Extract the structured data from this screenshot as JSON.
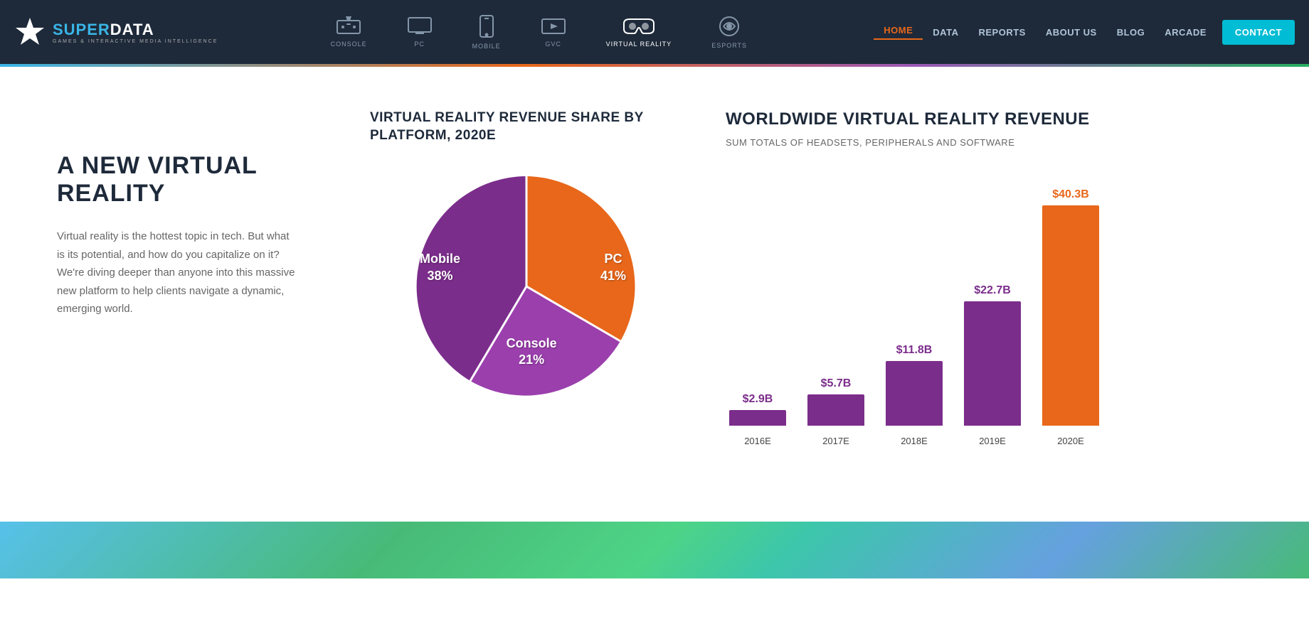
{
  "brand": {
    "name_part1": "SUPER",
    "name_part2": "DATA",
    "tagline": "GAMES & INTERACTIVE MEDIA INTELLIGENCE"
  },
  "categories": [
    {
      "id": "console",
      "label": "CONSOLE",
      "active": false
    },
    {
      "id": "pc",
      "label": "PC",
      "active": false
    },
    {
      "id": "mobile",
      "label": "MOBILE",
      "active": false
    },
    {
      "id": "gvc",
      "label": "GVC",
      "active": false
    },
    {
      "id": "virtual-reality",
      "label": "VIRTUAL REALITY",
      "active": true
    },
    {
      "id": "esports",
      "label": "ESPORTS",
      "active": false
    }
  ],
  "nav": {
    "items": [
      {
        "id": "home",
        "label": "HOME",
        "active": true
      },
      {
        "id": "data",
        "label": "DATA",
        "active": false
      },
      {
        "id": "reports",
        "label": "REPORTS",
        "active": false
      },
      {
        "id": "about-us",
        "label": "ABOUT US",
        "active": false
      },
      {
        "id": "blog",
        "label": "BLOG",
        "active": false
      },
      {
        "id": "arcade",
        "label": "ARCADE",
        "active": false
      }
    ],
    "contact_label": "CONTACT"
  },
  "hero": {
    "title": "A NEW VIRTUAL REALITY",
    "description": "Virtual reality is the hottest topic in tech. But what is its potential, and how do you capitalize on it? We're diving deeper than anyone into this massive new platform to help clients navigate a dynamic, emerging world."
  },
  "pie_chart": {
    "title": "VIRTUAL REALITY REVENUE SHARE BY PLATFORM, 2020E",
    "segments": [
      {
        "label": "PC",
        "value": 41,
        "color": "#e8671a"
      },
      {
        "label": "Mobile",
        "value": 38,
        "color": "#7b2d8b"
      },
      {
        "label": "Console",
        "value": 21,
        "color": "#9b3fad"
      }
    ]
  },
  "bar_chart": {
    "title": "WORLDWIDE VIRTUAL REALITY REVENUE",
    "subtitle": "SUM TOTALS OF HEADSETS, PERIPHERALS AND SOFTWARE",
    "bars": [
      {
        "year": "2016E",
        "value": "$2.9B",
        "amount": 2.9,
        "color": "purple"
      },
      {
        "year": "2017E",
        "value": "$5.7B",
        "amount": 5.7,
        "color": "purple"
      },
      {
        "year": "2018E",
        "value": "$11.8B",
        "amount": 11.8,
        "color": "purple"
      },
      {
        "year": "2019E",
        "value": "$22.7B",
        "amount": 22.7,
        "color": "purple"
      },
      {
        "year": "2020E",
        "value": "$40.3B",
        "amount": 40.3,
        "color": "orange"
      }
    ],
    "max_value": 40.3,
    "bar_max_height": 310
  }
}
